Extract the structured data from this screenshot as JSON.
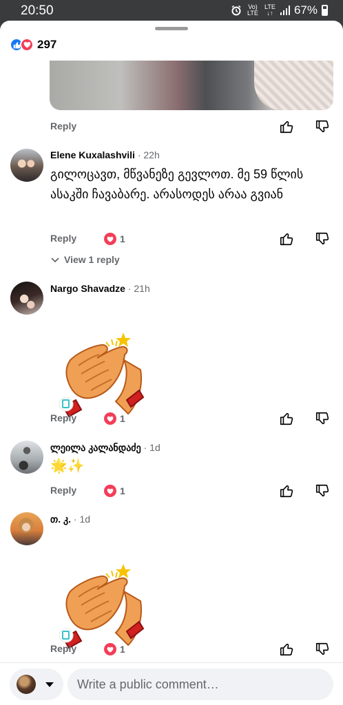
{
  "status": {
    "time": "20:50",
    "net1": "Vo) LTE",
    "net2": "LTE ↓↑",
    "battery": "67%"
  },
  "header": {
    "reaction_count": "297"
  },
  "reply_label": "Reply",
  "comments": [
    {
      "author": "Elene Kuxalashvili",
      "time": "· 22h",
      "text": "გილოცავთ, მწვანეზე გევლოთ. მე 59 წლის ასაკში ჩავაბარე. არასოდეს არაა გვიან",
      "loves": "1",
      "view_replies": "View 1 reply"
    },
    {
      "author": "Nargo Shavadze",
      "time": "· 21h",
      "loves": "1"
    },
    {
      "author": "ლეილა კალანდაძე",
      "time": "· 1d",
      "emoji": "🌟✨",
      "loves": "1"
    },
    {
      "author": "თ. კ.",
      "time": "· 1d",
      "loves": "1"
    }
  ],
  "composer": {
    "placeholder": "Write a public comment…"
  },
  "icons": [
    "like-icon",
    "love-icon",
    "thumbs-up-icon",
    "thumbs-down-icon",
    "chevron-down-icon",
    "caret-down-icon",
    "clapping-hands-sticker"
  ],
  "colors": {
    "like": "#1877f2",
    "love": "#f33e58",
    "secondary_text": "#65676b"
  }
}
